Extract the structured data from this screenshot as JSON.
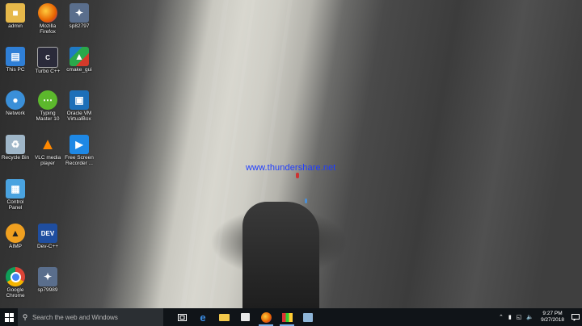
{
  "desktop": {
    "icons": [
      {
        "id": "admin",
        "label": "admin"
      },
      {
        "id": "firefox",
        "label": "Mozilla\nFirefox"
      },
      {
        "id": "sp82797",
        "label": "sp82797"
      },
      {
        "id": "this-pc",
        "label": "This PC"
      },
      {
        "id": "turbo-cpp",
        "label": "Turbo C++"
      },
      {
        "id": "cmake-gui",
        "label": "cmake_gui"
      },
      {
        "id": "network",
        "label": "Network"
      },
      {
        "id": "typing-master",
        "label": "Typing\nMaster 10"
      },
      {
        "id": "oracle-vm",
        "label": "Oracle VM\nVirtualBox"
      },
      {
        "id": "recycle-bin",
        "label": "Recycle Bin"
      },
      {
        "id": "vlc",
        "label": "VLC media\nplayer"
      },
      {
        "id": "free-screen-recorder",
        "label": "Free Screen\nRecorder ..."
      },
      {
        "id": "control-panel",
        "label": "Control\nPanel"
      },
      {
        "id": "aimp",
        "label": "AIMP"
      },
      {
        "id": "dev-cpp",
        "label": "Dev-C++"
      },
      {
        "id": "chrome",
        "label": "Google\nChrome"
      },
      {
        "id": "sp79989",
        "label": "sp79989"
      }
    ],
    "watermark": "www.thundershare.net",
    "devcpp_badge": "DEV"
  },
  "taskbar": {
    "search_placeholder": "Search the web and Windows",
    "time": "9:27 PM",
    "date": "9/27/2018",
    "accent": "#78aee8"
  }
}
